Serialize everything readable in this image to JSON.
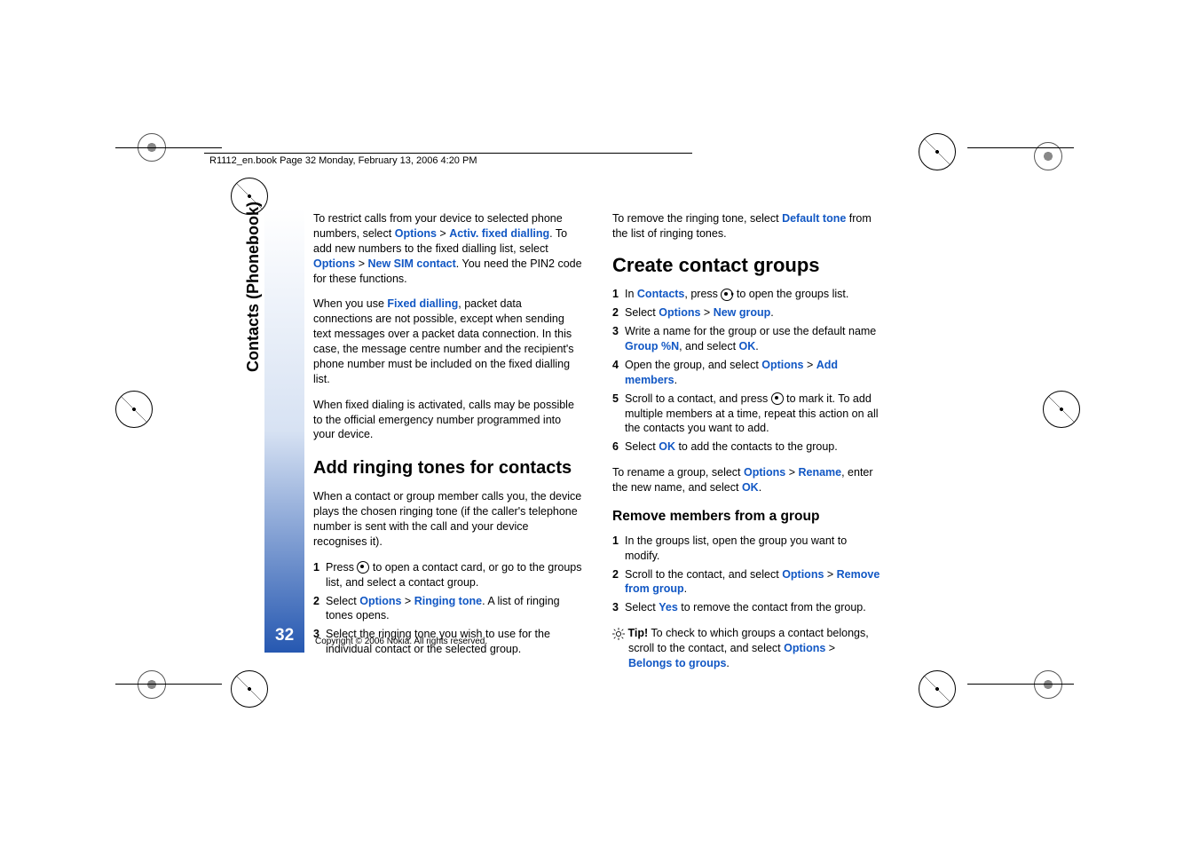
{
  "header": {
    "runner": "R1112_en.book  Page 32  Monday, February 13, 2006  4:20 PM"
  },
  "sidebar": {
    "section_title": "Contacts (Phonebook)",
    "page_number": "32"
  },
  "footer": {
    "copyright": "Copyright © 2006 Nokia. All rights reserved."
  },
  "body": {
    "p1a": "To restrict calls from your device to selected phone numbers, select ",
    "p1_opt": "Options",
    "p1_gt": " > ",
    "p1_act": "Activ. fixed dialling",
    "p1b": ". To add new numbers to the fixed dialling list, select ",
    "p1_opt2": "Options",
    "p1_gt2": " > ",
    "p1_new": "New SIM contact",
    "p1c": ". You need the PIN2 code for these functions.",
    "p2a": "When you use ",
    "p2_fd": "Fixed dialling",
    "p2b": ", packet data connections are not possible, except when sending text messages over a packet data connection. In this case, the message centre number and the recipient's phone number must be included on the fixed dialling list.",
    "p3": "When fixed dialing is activated, calls may be possible to the official emergency number programmed into your device.",
    "h_ring": "Add ringing tones for contacts",
    "p4": "When a contact or group member calls you, the device plays the chosen ringing tone (if the caller's telephone number is sent with the call and your device recognises it).",
    "steps_ring": [
      {
        "n": "1",
        "a": "Press ",
        "icon": true,
        "b": " to open a contact card, or go to the groups list, and select a contact group."
      },
      {
        "n": "2",
        "a": "Select ",
        "blue1": "Options",
        "mid": " > ",
        "blue2": "Ringing tone",
        "b": ". A list of ringing tones opens."
      },
      {
        "n": "3",
        "a": "Select the ringing tone you wish to use for the individual contact or the selected group."
      }
    ],
    "p5a": "To remove the ringing tone, select ",
    "p5_def": "Default tone",
    "p5b": " from the list of ringing tones.",
    "h_create": "Create contact groups",
    "steps_create": [
      {
        "n": "1",
        "a": "In ",
        "blue1": "Contacts",
        "mid": ", press ",
        "iconRight": true,
        "b": " to open the groups list."
      },
      {
        "n": "2",
        "a": "Select ",
        "blue1": "Options",
        "mid": " > ",
        "blue2": "New group",
        "b": "."
      },
      {
        "n": "3",
        "a": "Write a name for the group or use the default name ",
        "blue1": "Group %N",
        "mid": ", and select ",
        "blue2": "OK",
        "b": "."
      },
      {
        "n": "4",
        "a": "Open the group, and select ",
        "blue1": "Options",
        "mid": " > ",
        "blue2": "Add members",
        "b": "."
      },
      {
        "n": "5",
        "a": "Scroll to a contact, and press ",
        "icon": true,
        "mid": " to mark it. To add multiple members at a time, repeat this action on all the contacts you want to add."
      },
      {
        "n": "6",
        "a": "Select ",
        "blue1": "OK",
        "b": " to add the contacts to the group."
      }
    ],
    "p6a": "To rename a group, select ",
    "p6_opt": "Options",
    "p6_gt": " > ",
    "p6_ren": "Rename",
    "p6b": ", enter the new name, and select ",
    "p6_ok": "OK",
    "p6c": ".",
    "h_remove": "Remove members from a group",
    "steps_remove": [
      {
        "n": "1",
        "a": "In the groups list, open the group you want to modify."
      },
      {
        "n": "2",
        "a": "Scroll to the contact, and select ",
        "blue1": "Options",
        "mid": " > ",
        "blue2": "Remove from group",
        "b": "."
      },
      {
        "n": "3",
        "a": "Select ",
        "blue1": "Yes",
        "b": " to remove the contact from the group."
      }
    ],
    "tip_a": "Tip!",
    "tip_b": " To check to which groups a contact belongs, scroll to the contact, and select ",
    "tip_opt": "Options",
    "tip_gt": " > ",
    "tip_bel": "Belongs to groups",
    "tip_c": "."
  }
}
